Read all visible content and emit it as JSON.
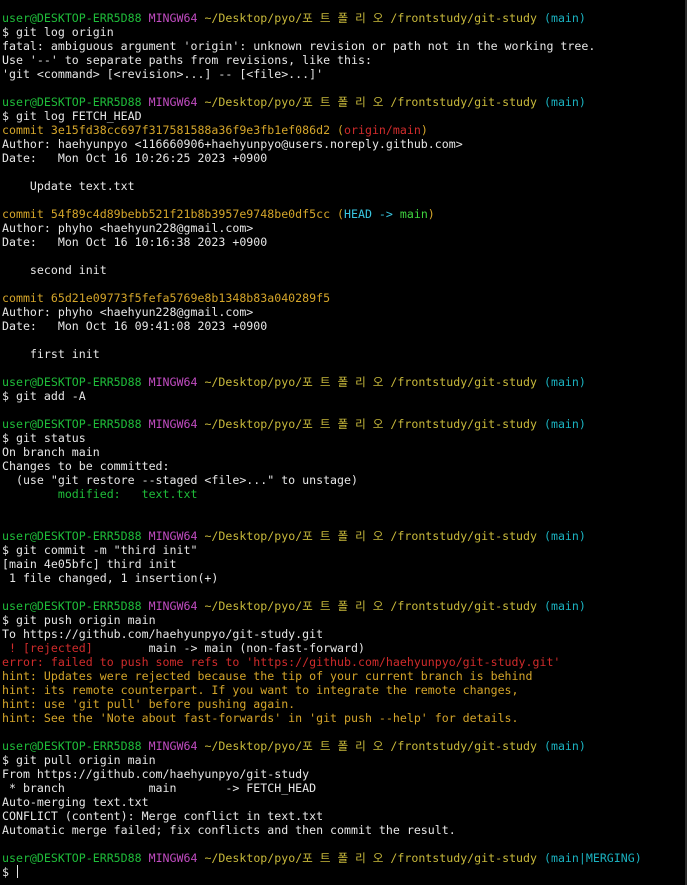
{
  "prompt": {
    "user_host": "user@DESKTOP-ERR5D88",
    "shell": "MINGW64",
    "path": "~/Desktop/pyo/포트폴리오/frontstudy/git-study",
    "path_display": "~/Desktop/pyo/포 트 폴 리 오 /frontstudy/git-study",
    "branch": "(main)",
    "branch_merging": "(main|MERGING)",
    "dollar": "$"
  },
  "block1": {
    "cmd": " git log origin",
    "l1": "fatal: ambiguous argument 'origin': unknown revision or path not in the working tree.",
    "l2": "Use '--' to separate paths from revisions, like this:",
    "l3": "'git <command> [<revision>...] -- [<file>...]'"
  },
  "block2": {
    "cmd": " git log FETCH_HEAD",
    "c1_hash": "commit 3e15fd38cc697f317581588a36f9e3fb1ef086d2",
    "c1_ref": "origin/main",
    "c1_author": "Author: haehyunpyo <116660906+haehyunpyo@users.noreply.github.com>",
    "c1_date": "Date:   Mon Oct 16 10:26:25 2023 +0900",
    "c1_msg": "    Update text.txt",
    "c2_hash": "commit 54f89c4d89bebb521f21b8b3957e9748be0df5cc",
    "c2_head": "HEAD",
    "c2_arrow": " -> ",
    "c2_main": "main",
    "c2_author": "Author: phyho <haehyun228@gmail.com>",
    "c2_date": "Date:   Mon Oct 16 10:16:38 2023 +0900",
    "c2_msg": "    second init",
    "c3_hash": "commit 65d21e09773f5fefa5769e8b1348b83a040289f5",
    "c3_author": "Author: phyho <haehyun228@gmail.com>",
    "c3_date": "Date:   Mon Oct 16 09:41:08 2023 +0900",
    "c3_msg": "    first init"
  },
  "block3": {
    "cmd": " git add -A"
  },
  "block4": {
    "cmd": " git status",
    "l1": "On branch main",
    "l2": "Changes to be committed:",
    "l3": "  (use \"git restore --staged <file>...\" to unstage)",
    "l4": "        modified:   text.txt"
  },
  "block5": {
    "cmd": " git commit -m \"third init\"",
    "l1": "[main 4e05bfc] third init",
    "l2": " 1 file changed, 1 insertion(+)"
  },
  "block6": {
    "cmd": " git push origin main",
    "l1": "To https://github.com/haehyunpyo/git-study.git",
    "l2_rejected": " ! [rejected]",
    "l2_rest": "        main -> main (non-fast-forward)",
    "l3": "error: failed to push some refs to 'https://github.com/haehyunpyo/git-study.git'",
    "l4": "hint: Updates were rejected because the tip of your current branch is behind",
    "l5": "hint: its remote counterpart. If you want to integrate the remote changes,",
    "l6": "hint: use 'git pull' before pushing again.",
    "l7": "hint: See the 'Note about fast-forwards' in 'git push --help' for details."
  },
  "block7": {
    "cmd": " git pull origin main",
    "l1": "From https://github.com/haehyunpyo/git-study",
    "l2": " * branch            main       -> FETCH_HEAD",
    "l3": "Auto-merging text.txt",
    "l4": "CONFLICT (content): Merge conflict in text.txt",
    "l5": "Automatic merge failed; fix conflicts and then commit the result."
  },
  "final": {
    "dollar": "$ "
  },
  "colors": {
    "background": "#000000",
    "text": "#e6e6e6",
    "user_host": "#1fbd3a",
    "shell": "#c14cc1",
    "path": "#c8b93b",
    "branch": "#1ab1bf",
    "error": "#cf2b2b",
    "hint": "#d4a52a"
  }
}
